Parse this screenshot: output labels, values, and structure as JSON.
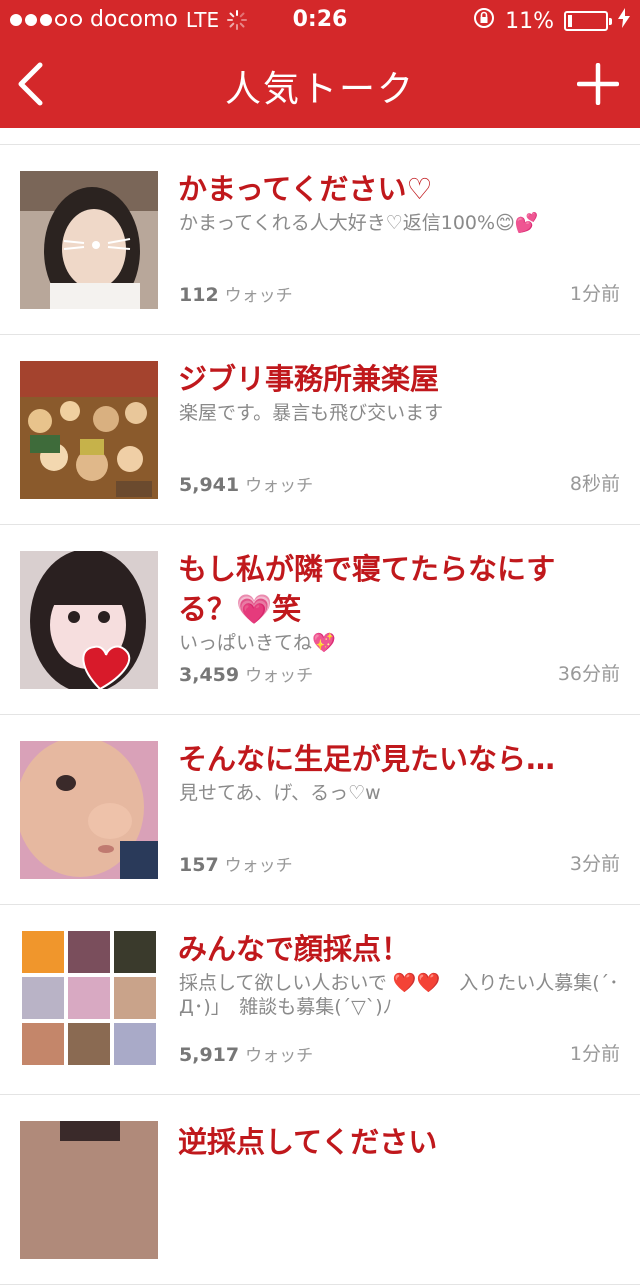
{
  "status_bar": {
    "carrier": "docomo",
    "network": "LTE",
    "time": "0:26",
    "battery_percent": "11%",
    "battery_level": 0.11,
    "signal_bars_filled": 3,
    "signal_bars_total": 5
  },
  "nav": {
    "title": "人気トーク",
    "back_icon": "chevron-left-icon",
    "add_icon": "plus-icon"
  },
  "colors": {
    "brand_red": "#d4282a",
    "title_red": "#c0181c",
    "text_gray": "#8a8a8a"
  },
  "watch_label": "ウォッチ",
  "talks": [
    {
      "title": "かまってください♡",
      "description": "かまってくれる人大好き♡返信100%😊💕",
      "watchers": "112",
      "time_ago": "1分前"
    },
    {
      "title": "ジブリ事務所兼楽屋",
      "description": "楽屋です。暴言も飛び交います",
      "watchers": "5,941",
      "time_ago": "8秒前"
    },
    {
      "title": "もし私が隣で寝てたらなにする？💗笑",
      "description": "いっぱいきてね💖",
      "watchers": "3,459",
      "time_ago": "36分前"
    },
    {
      "title": "そんなに生足が見たいなら…",
      "description": "見せてあ、げ、るっ♡w",
      "watchers": "157",
      "time_ago": "3分前"
    },
    {
      "title": "みんなで顔採点！",
      "description": "採点して欲しい人おいで ❤️❤️　入りたい人募集(´･Д･)」　雑談も募集(´▽`)ﾉ",
      "watchers": "5,917",
      "time_ago": "1分前"
    },
    {
      "title": "逆採点してください"
    }
  ]
}
